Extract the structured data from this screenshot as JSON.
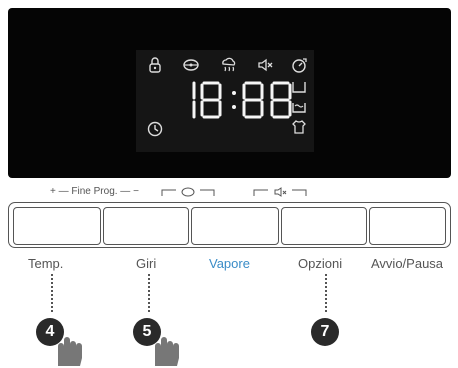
{
  "display": {
    "time": "18:88",
    "icons": [
      "lock-icon",
      "spin-icon",
      "steam-icon",
      "mute-icon",
      "delay-end-icon",
      "wash-icon",
      "rinse-icon",
      "dry-icon",
      "clock-icon"
    ]
  },
  "top_labels": {
    "fine_prog": "+ — Fine Prog. — −"
  },
  "buttons": [
    {
      "label": "Temp."
    },
    {
      "label": "Giri"
    },
    {
      "label": "Vapore"
    },
    {
      "label": "Opzioni"
    },
    {
      "label": "Avvio/Pausa"
    }
  ],
  "callouts": [
    "4",
    "5",
    "7"
  ],
  "colors": {
    "accent": "#3a8cc7",
    "panel": "#050505",
    "text": "#555555"
  }
}
